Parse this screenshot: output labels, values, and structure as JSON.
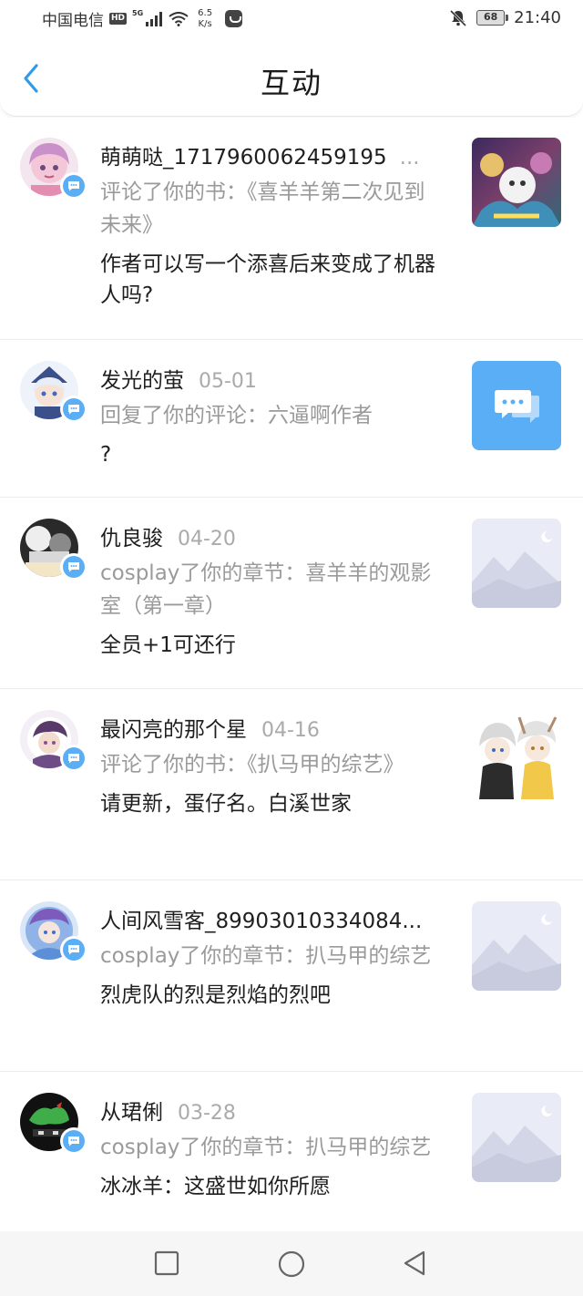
{
  "status_bar": {
    "carrier": "中国电信",
    "hd": "HD",
    "network": "5G",
    "speed_value": "6.5",
    "speed_unit": "K/s",
    "battery": "68",
    "time": "21:40"
  },
  "header": {
    "title": "互动",
    "back_icon": "chevron-left-icon"
  },
  "items": [
    {
      "name": "萌萌哒_1717960062459195",
      "date": "",
      "more": "...",
      "action": "评论了你的书：《喜羊羊第二次见到未来》",
      "comment": "作者可以写一个添喜后来变成了机器人吗?",
      "thumb": "book-cover-image"
    },
    {
      "name": "发光的萤",
      "date": "05-01",
      "action": "回复了你的评论：六逼啊作者",
      "comment": "?",
      "thumb": "chat-bubble-icon"
    },
    {
      "name": "仇良骏",
      "date": "04-20",
      "action": "cosplay了你的章节：喜羊羊的观影室（第一章）",
      "comment": "全员+1可还行",
      "thumb": "placeholder-mountain-image"
    },
    {
      "name": "最闪亮的那个星",
      "date": "04-16",
      "action": "评论了你的书：《扒马甲的综艺》",
      "comment": "请更新，蛋仔名。白溪世家",
      "thumb": "anime-characters-image"
    },
    {
      "name": "人间风雪客_89903010334084...",
      "date": "",
      "action": "cosplay了你的章节：扒马甲的综艺",
      "comment": "烈虎队的烈是烈焰的烈吧",
      "thumb": "placeholder-mountain-image"
    },
    {
      "name": "从珺俐",
      "date": "03-28",
      "action": "cosplay了你的章节：扒马甲的综艺",
      "comment": "冰冰羊：这盛世如你所愿",
      "thumb": "placeholder-mountain-image"
    }
  ],
  "colors": {
    "accent": "#5aaef6",
    "back_arrow": "#2f9bea",
    "muted_text": "#9a9a9a",
    "date_text": "#aaaaaa"
  },
  "nav_bar": {
    "recents_icon": "square-icon",
    "home_icon": "circle-icon",
    "back_icon": "triangle-back-icon"
  }
}
